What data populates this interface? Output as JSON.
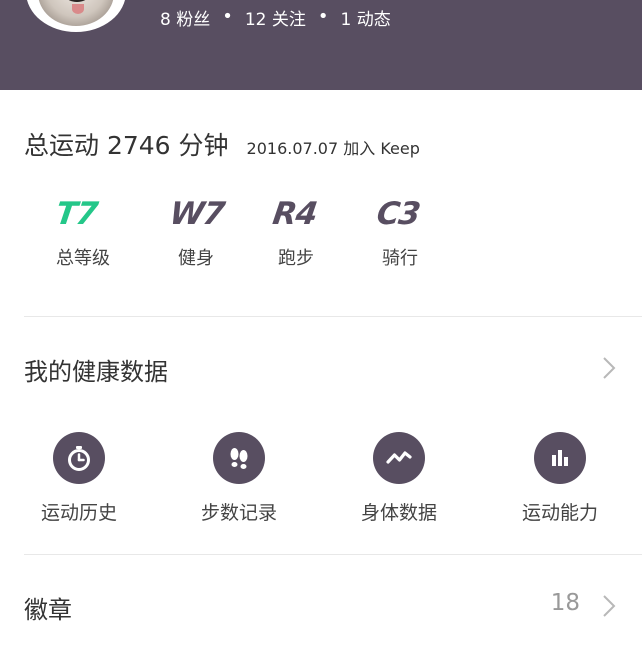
{
  "profile": {
    "followers": "8 粉丝",
    "following": "12 关注",
    "posts": "1 动态",
    "separator": "•"
  },
  "summary": {
    "total": "总运动 2746 分钟",
    "joined": "2016.07.07 加入 Keep"
  },
  "levels": [
    {
      "code": "T7",
      "name": "总等级"
    },
    {
      "code": "W7",
      "name": "健身"
    },
    {
      "code": "R4",
      "name": "跑步"
    },
    {
      "code": "C3",
      "name": "骑行"
    }
  ],
  "health": {
    "title": "我的健康数据",
    "items": [
      {
        "label": "运动历史",
        "icon": "stopwatch-icon"
      },
      {
        "label": "步数记录",
        "icon": "footprints-icon"
      },
      {
        "label": "身体数据",
        "icon": "trend-line-icon"
      },
      {
        "label": "运动能力",
        "icon": "bar-chart-icon"
      }
    ]
  },
  "badges": {
    "title": "徽章",
    "count": "18"
  },
  "colors": {
    "header_bg": "#584e61",
    "accent_green": "#24c789",
    "icon_bg": "#584e61"
  }
}
